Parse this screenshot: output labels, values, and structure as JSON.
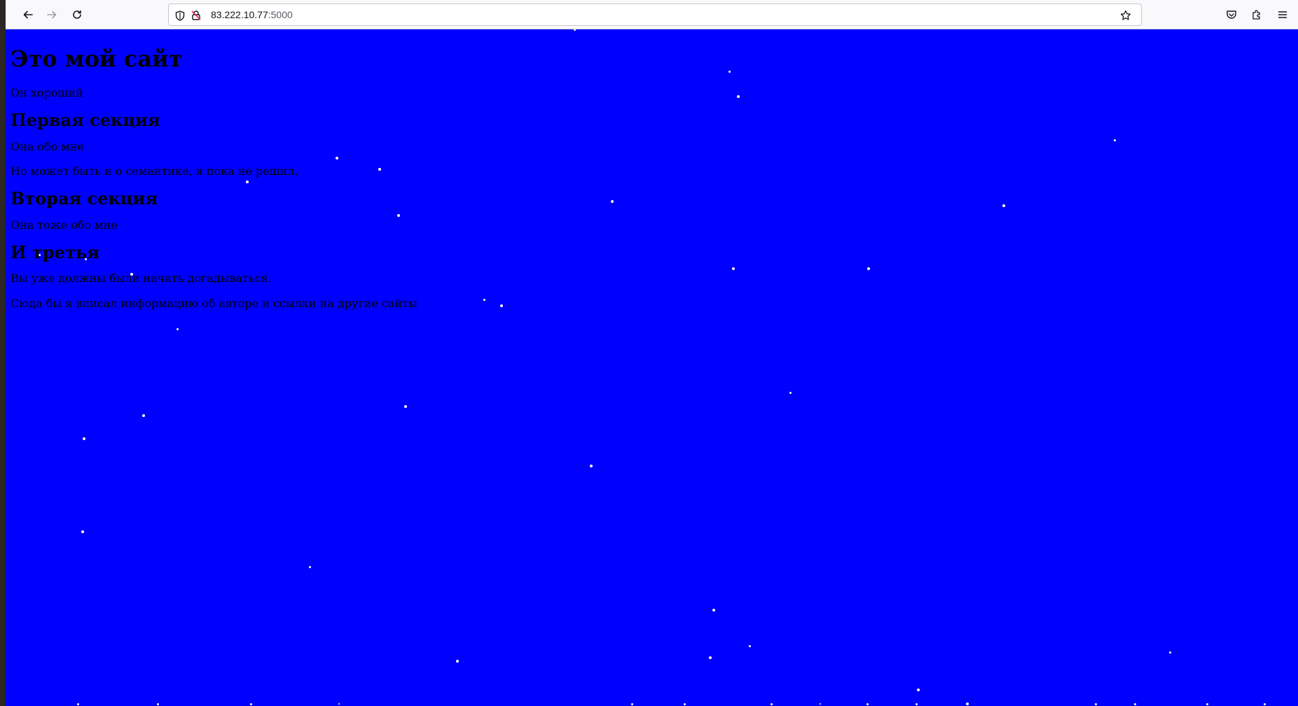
{
  "browser": {
    "url_host": "83.222.10.77",
    "url_port": ":5000",
    "icons": {
      "back": "arrow-left-icon",
      "forward": "arrow-right-icon",
      "reload": "reload-icon",
      "tracking": "shield-icon",
      "insecure": "insecure-lock-icon",
      "bookmark": "star-icon",
      "pocket": "pocket-icon",
      "extensions": "puzzle-icon",
      "menu": "hamburger-menu-icon"
    }
  },
  "page": {
    "background_color": "#0000ff",
    "star_color": "#ffffff",
    "title": "Это мой сайт",
    "subtitle": "Он хороший",
    "sections": [
      {
        "heading": "Первая секция",
        "paragraphs": [
          "Она обо мне",
          "Но может быть и о семантике, я пока не решил."
        ]
      },
      {
        "heading": "Вторая секция",
        "paragraphs": [
          "Она тоже обо мне"
        ]
      },
      {
        "heading": "И третья",
        "paragraphs": [
          "Вы уже должны были начать догадываться.",
          "Сюда бы я вписал информацию об авторе и ссылки на другие сайты"
        ]
      }
    ]
  }
}
